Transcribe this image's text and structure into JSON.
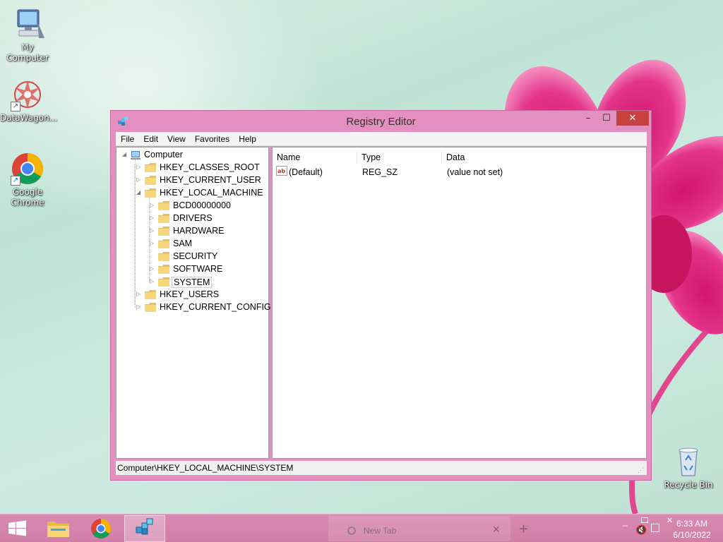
{
  "desktop": {
    "icons": [
      {
        "label": "My Computer",
        "icon": "computer-icon"
      },
      {
        "label": "DataWagon...",
        "icon": "datawagon-icon"
      },
      {
        "label": "Google\nChrome",
        "line1": "Google",
        "line2": "Chrome",
        "icon": "chrome-icon"
      },
      {
        "label": "Recycle Bin",
        "icon": "recycle-bin-icon"
      }
    ]
  },
  "window": {
    "title": "Registry Editor",
    "controls": {
      "minimize": "–",
      "maximize": "☐",
      "close": "✕"
    },
    "menu": [
      "File",
      "Edit",
      "View",
      "Favorites",
      "Help"
    ],
    "tree": {
      "root": "Computer",
      "hives": [
        "HKEY_CLASSES_ROOT",
        "HKEY_CURRENT_USER",
        "HKEY_LOCAL_MACHINE",
        "HKEY_USERS",
        "HKEY_CURRENT_CONFIG"
      ],
      "hklm_children": [
        "BCD00000000",
        "DRIVERS",
        "HARDWARE",
        "SAM",
        "SECURITY",
        "SOFTWARE",
        "SYSTEM"
      ],
      "selected": "SYSTEM"
    },
    "list": {
      "columns": [
        "Name",
        "Type",
        "Data"
      ],
      "rows": [
        {
          "name": "(Default)",
          "type": "REG_SZ",
          "data": "(value not set)"
        }
      ]
    },
    "status": "Computer\\HKEY_LOCAL_MACHINE\\SYSTEM"
  },
  "taskbar": {
    "buttons": [
      "start-button",
      "file-explorer",
      "chrome",
      "registry-editor"
    ],
    "active": "registry-editor",
    "tab_label": "New Tab",
    "tab_close": "✕",
    "tab_new": "+",
    "clock": {
      "time": "6:33 AM",
      "date": "6/10/2022"
    }
  },
  "colors": {
    "window_frame": "#e38fbf",
    "close_button": "#c7423f",
    "taskbar": "#d07ea8"
  }
}
